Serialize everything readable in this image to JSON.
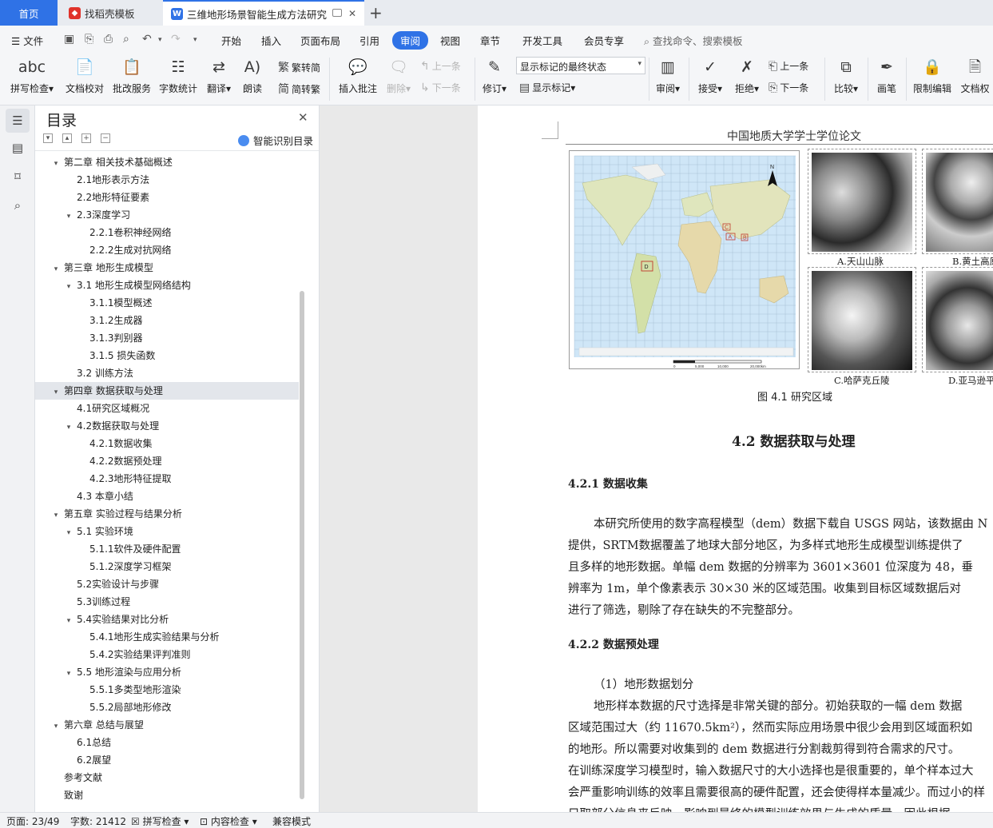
{
  "tabs": [
    {
      "label": "首页"
    },
    {
      "label": "找稻壳模板"
    },
    {
      "label": "三维地形场景智能生成方法研究"
    }
  ],
  "menu": {
    "file": "文件",
    "items": [
      "开始",
      "插入",
      "页面布局",
      "引用",
      "审阅",
      "视图",
      "章节",
      "开发工具",
      "会员专享"
    ],
    "active": "审阅",
    "search": "查找命令、搜索模板"
  },
  "ribbon": {
    "spell": "拼写检查",
    "proofread": "文档校对",
    "annotate_service": "批改服务",
    "word_count": "字数统计",
    "translate": "翻译",
    "read_aloud": "朗读",
    "trad": "繁转简",
    "simp": "简转繁",
    "insert_comment": "插入批注",
    "delete": "删除",
    "prev": "上一条",
    "next": "下一条",
    "track": "修订",
    "markup_state": "显示标记的最终状态",
    "show_markup": "显示标记",
    "review": "审阅",
    "accept": "接受",
    "reject": "拒绝",
    "prev2": "上一条",
    "next2": "下一条",
    "compare": "比较",
    "pen": "画笔",
    "restrict": "限制编辑",
    "doc_perm": "文档权"
  },
  "toc": {
    "title": "目录",
    "smart": "智能识别目录",
    "items": [
      {
        "label": "第二章 相关技术基础概述",
        "level": 1,
        "exp": true
      },
      {
        "label": "2.1地形表示方法",
        "level": 2
      },
      {
        "label": "2.2地形特征要素",
        "level": 2
      },
      {
        "label": "2.3深度学习",
        "level": 2,
        "exp": true
      },
      {
        "label": "2.2.1卷积神经网络",
        "level": 3
      },
      {
        "label": "2.2.2生成对抗网络",
        "level": 3
      },
      {
        "label": "第三章 地形生成模型",
        "level": 1,
        "exp": true
      },
      {
        "label": "3.1 地形生成模型网络结构",
        "level": 2,
        "exp": true
      },
      {
        "label": "3.1.1模型概述",
        "level": 3
      },
      {
        "label": "3.1.2生成器",
        "level": 3
      },
      {
        "label": "3.1.3判别器",
        "level": 3
      },
      {
        "label": "3.1.5 损失函数",
        "level": 3
      },
      {
        "label": "3.2 训练方法",
        "level": 2
      },
      {
        "label": "第四章 数据获取与处理",
        "level": 1,
        "exp": true,
        "sel": true
      },
      {
        "label": "4.1研究区域概况",
        "level": 2
      },
      {
        "label": "4.2数据获取与处理",
        "level": 2,
        "exp": true
      },
      {
        "label": "4.2.1数据收集",
        "level": 3
      },
      {
        "label": "4.2.2数据预处理",
        "level": 3
      },
      {
        "label": "4.2.3地形特征提取",
        "level": 3
      },
      {
        "label": "4.3 本章小结",
        "level": 2
      },
      {
        "label": "第五章 实验过程与结果分析",
        "level": 1,
        "exp": true
      },
      {
        "label": "5.1 实验环境",
        "level": 2,
        "exp": true
      },
      {
        "label": "5.1.1软件及硬件配置",
        "level": 3
      },
      {
        "label": "5.1.2深度学习框架",
        "level": 3
      },
      {
        "label": "5.2实验设计与步骤",
        "level": 2
      },
      {
        "label": "5.3训练过程",
        "level": 2
      },
      {
        "label": "5.4实验结果对比分析",
        "level": 2,
        "exp": true
      },
      {
        "label": "5.4.1地形生成实验结果与分析",
        "level": 3
      },
      {
        "label": "5.4.2实验结果评判准则",
        "level": 3
      },
      {
        "label": "5.5 地形渲染与应用分析",
        "level": 2,
        "exp": true
      },
      {
        "label": "5.5.1多类型地形渲染",
        "level": 3
      },
      {
        "label": "5.5.2局部地形修改",
        "level": 3
      },
      {
        "label": "第六章 总结与展望",
        "level": 1,
        "exp": true
      },
      {
        "label": "6.1总结",
        "level": 2
      },
      {
        "label": "6.2展望",
        "level": 2
      },
      {
        "label": "参考文献",
        "level": 1
      },
      {
        "label": "致谢",
        "level": 1
      }
    ]
  },
  "doc": {
    "header": "中国地质大学学士学位论文",
    "fig_caption": "图 4.1 研究区域",
    "map_labels": {
      "north": "N",
      "c": "C",
      "a": "A",
      "b": "B",
      "d": "D",
      "scale": [
        "0",
        "5,000",
        "10,000",
        "20,000km"
      ]
    },
    "dem_labels": [
      "A.天山山脉",
      "B.黄土高原",
      "C.哈萨克丘陵",
      "D.亚马逊平"
    ],
    "section_title": "4.2 数据获取与处理",
    "sub1": "4.2.1   数据收集",
    "para1": [
      "本研究所使用的数字高程模型（dem）数据下载自 USGS 网站，该数据由 N",
      "提供，SRTM数据覆盖了地球大部分地区，为多样式地形生成模型训练提供了",
      "且多样的地形数据。单幅 dem 数据的分辨率为 3601×3601 位深度为 48，垂",
      "辨率为 1m，单个像素表示 30×30 米的区域范围。收集到目标区域数据后对",
      "进行了筛选，剔除了存在缺失的不完整部分。"
    ],
    "sub2": "4.2.2   数据预处理",
    "para2_head": "（1）地形数据划分",
    "para2": [
      "地形样本数据的尺寸选择是非常关键的部分。初始获取的一幅 dem 数据",
      "区域范围过大（约 11670.5km²），然而实际应用场景中很少会用到区域面积如",
      "的地形。所以需要对收集到的 dem 数据进行分割裁剪得到符合需求的尺寸。",
      "在训练深度学习模型时，输入数据尺寸的大小选择也是很重要的，单个样本过大",
      "会严重影响训练的效率且需要很高的硬件配置，还会使得样本量减少。而过小的样",
      "只取部分信息来反映，影响到最终的模型训练效果与生成的质量，因此根据"
    ]
  },
  "status": {
    "page": "页面: 23/49",
    "words": "字数: 21412",
    "spell": "拼写检查",
    "content": "内容检查",
    "compat": "兼容模式"
  },
  "colors": {
    "accent": "#2f72e6",
    "ocean": "#cfe6f7",
    "land": "#d9e2b8",
    "marker": "#c0392b"
  }
}
